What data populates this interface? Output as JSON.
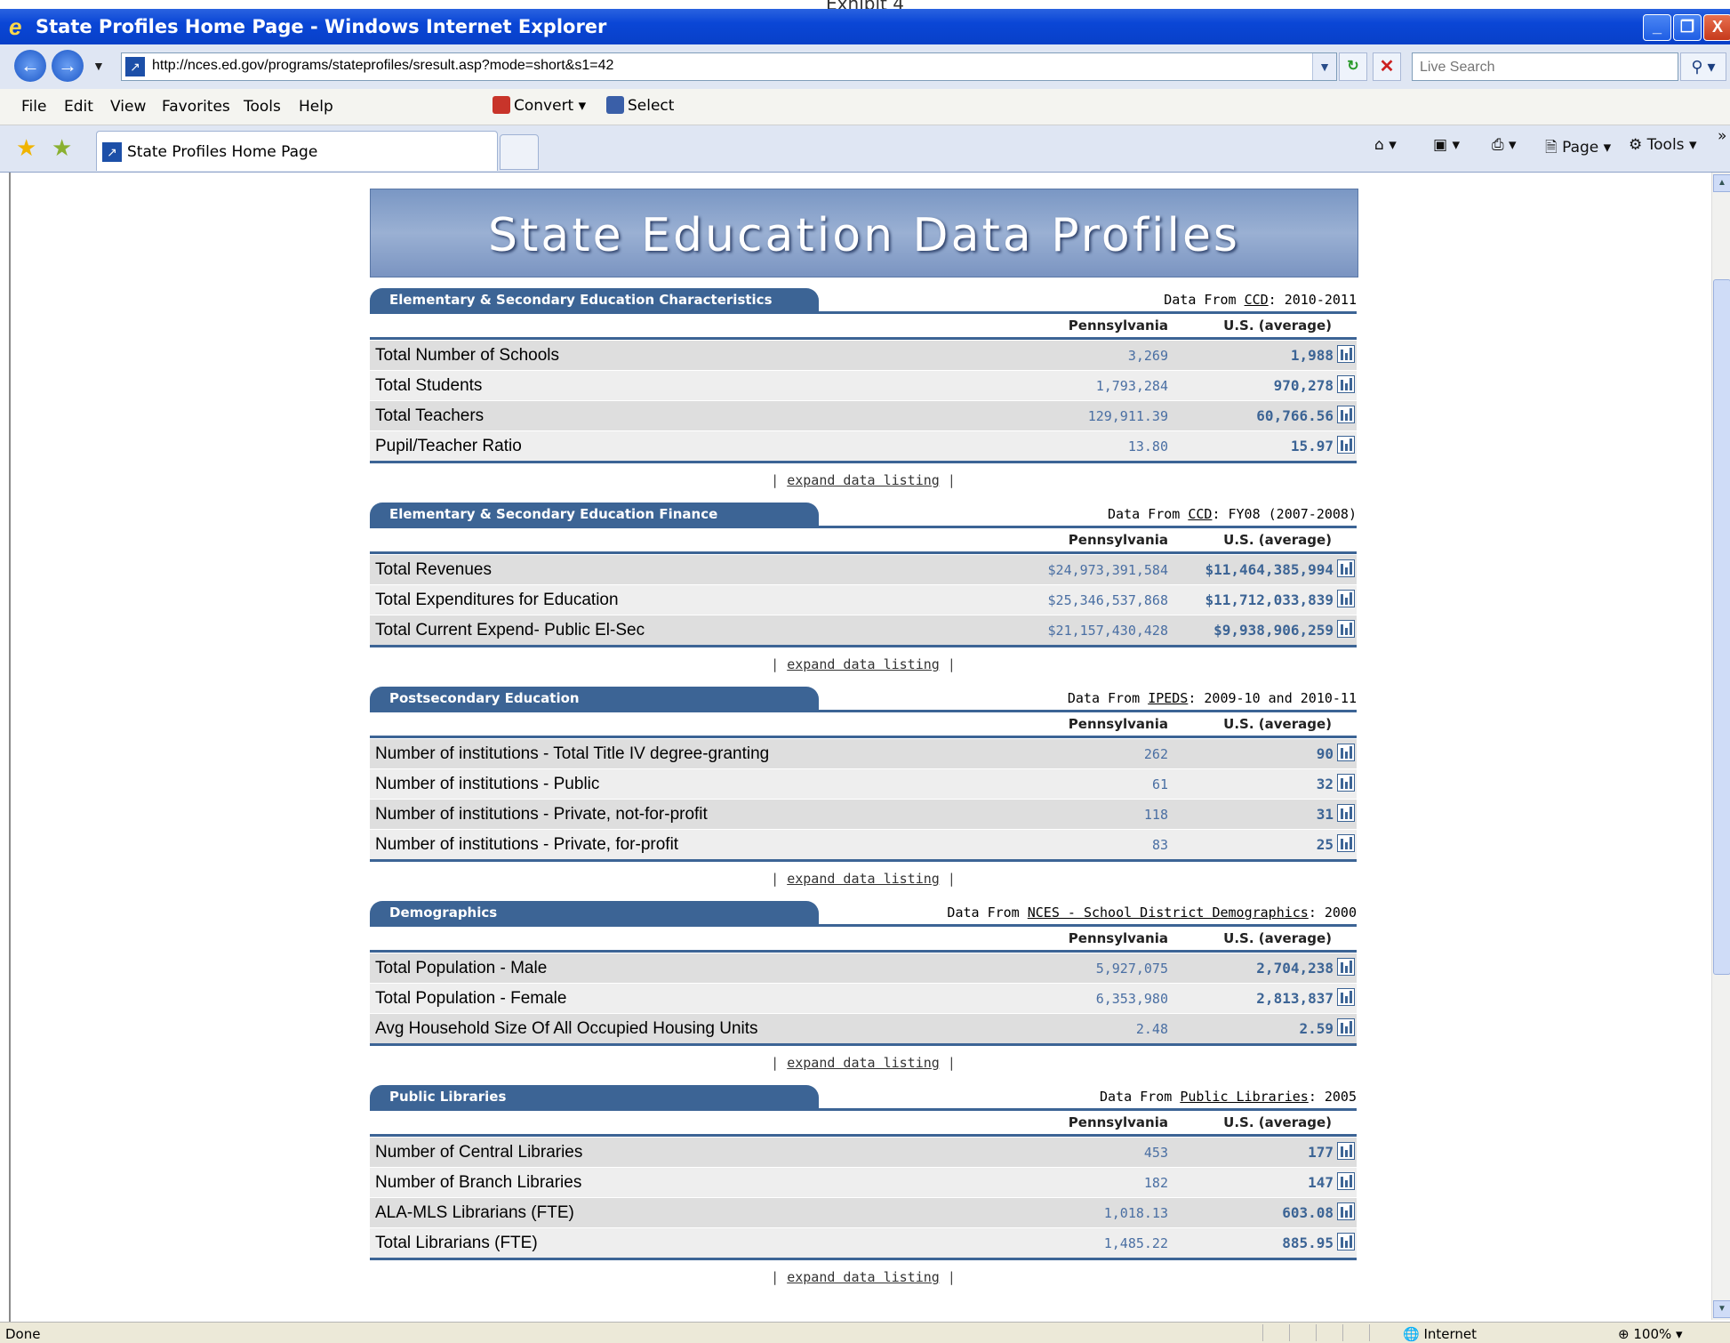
{
  "exhibit_label": "Exhibit 4",
  "window": {
    "title": "State Profiles Home Page - Windows Internet Explorer",
    "buttons": {
      "minimize": "_",
      "maximize": "❐",
      "close": "X"
    }
  },
  "address_bar": {
    "url": "http://nces.ed.gov/programs/stateprofiles/sresult.asp?mode=short&s1=42",
    "search_placeholder": "Live Search"
  },
  "menu": {
    "items": [
      "File",
      "Edit",
      "View",
      "Favorites",
      "Tools",
      "Help"
    ],
    "convert_label": "Convert",
    "select_label": "Select"
  },
  "tabs": {
    "active_label": "State Profiles Home Page",
    "page_label": "Page",
    "tools_label": "Tools"
  },
  "banner": {
    "title": "State Education Data Profiles"
  },
  "sections": [
    {
      "title": "Elementary & Secondary Education Characteristics",
      "source_prefix": "Data From ",
      "source_link": "CCD",
      "source_suffix": ": 2010-2011",
      "col_state": "Pennsylvania",
      "col_us": "U.S. (average)",
      "rows": [
        {
          "label": "Total Number of Schools",
          "state": "3,269",
          "us": "1,988"
        },
        {
          "label": "Total Students",
          "state": "1,793,284",
          "us": "970,278"
        },
        {
          "label": "Total Teachers",
          "state": "129,911.39",
          "us": "60,766.56"
        },
        {
          "label": "Pupil/Teacher Ratio",
          "state": "13.80",
          "us": "15.97"
        }
      ],
      "expand": "expand data listing"
    },
    {
      "title": "Elementary & Secondary Education Finance",
      "source_prefix": "Data From ",
      "source_link": "CCD",
      "source_suffix": ": FY08 (2007-2008)",
      "col_state": "Pennsylvania",
      "col_us": "U.S. (average)",
      "rows": [
        {
          "label": "Total Revenues",
          "state": "$24,973,391,584",
          "us": "$11,464,385,994"
        },
        {
          "label": "Total Expenditures for Education",
          "state": "$25,346,537,868",
          "us": "$11,712,033,839"
        },
        {
          "label": "Total Current Expend- Public El-Sec",
          "state": "$21,157,430,428",
          "us": "$9,938,906,259"
        }
      ],
      "expand": "expand data listing"
    },
    {
      "title": "Postsecondary Education",
      "source_prefix": "Data From ",
      "source_link": "IPEDS",
      "source_suffix": ": 2009-10 and 2010-11",
      "col_state": "Pennsylvania",
      "col_us": "U.S. (average)",
      "rows": [
        {
          "label": "Number of institutions - Total Title IV degree-granting",
          "state": "262",
          "us": "90"
        },
        {
          "label": "Number of institutions - Public",
          "state": "61",
          "us": "32"
        },
        {
          "label": "Number of institutions - Private, not-for-profit",
          "state": "118",
          "us": "31"
        },
        {
          "label": "Number of institutions - Private, for-profit",
          "state": "83",
          "us": "25"
        }
      ],
      "expand": "expand data listing"
    },
    {
      "title": "Demographics",
      "source_prefix": "Data From ",
      "source_link": "NCES - School District Demographics",
      "source_suffix": ": 2000",
      "col_state": "Pennsylvania",
      "col_us": "U.S. (average)",
      "rows": [
        {
          "label": "Total Population - Male",
          "state": "5,927,075",
          "us": "2,704,238"
        },
        {
          "label": "Total Population - Female",
          "state": "6,353,980",
          "us": "2,813,837"
        },
        {
          "label": "Avg Household Size Of All Occupied Housing Units",
          "state": "2.48",
          "us": "2.59"
        }
      ],
      "expand": "expand data listing"
    },
    {
      "title": "Public Libraries",
      "source_prefix": "Data From ",
      "source_link": "Public Libraries",
      "source_suffix": ": 2005",
      "col_state": "Pennsylvania",
      "col_us": "U.S. (average)",
      "rows": [
        {
          "label": "Number of Central Libraries",
          "state": "453",
          "us": "177"
        },
        {
          "label": "Number of Branch Libraries",
          "state": "182",
          "us": "147"
        },
        {
          "label": "ALA-MLS Librarians (FTE)",
          "state": "1,018.13",
          "us": "603.08"
        },
        {
          "label": "Total Librarians (FTE)",
          "state": "1,485.22",
          "us": "885.95"
        }
      ],
      "expand": "expand data listing"
    }
  ],
  "statusbar": {
    "status": "Done",
    "zone": "Internet",
    "zoom": "100%"
  },
  "colors": {
    "accent": "#3c6495",
    "titlebar": "#0a46d6"
  },
  "icons": [
    "ie-logo-icon",
    "back-icon",
    "forward-icon",
    "refresh-icon",
    "stop-icon",
    "search-icon",
    "favorites-star-icon",
    "add-favorites-icon",
    "home-icon",
    "feeds-icon",
    "print-icon",
    "page-icon",
    "tools-gear-icon",
    "bar-chart-icon"
  ]
}
